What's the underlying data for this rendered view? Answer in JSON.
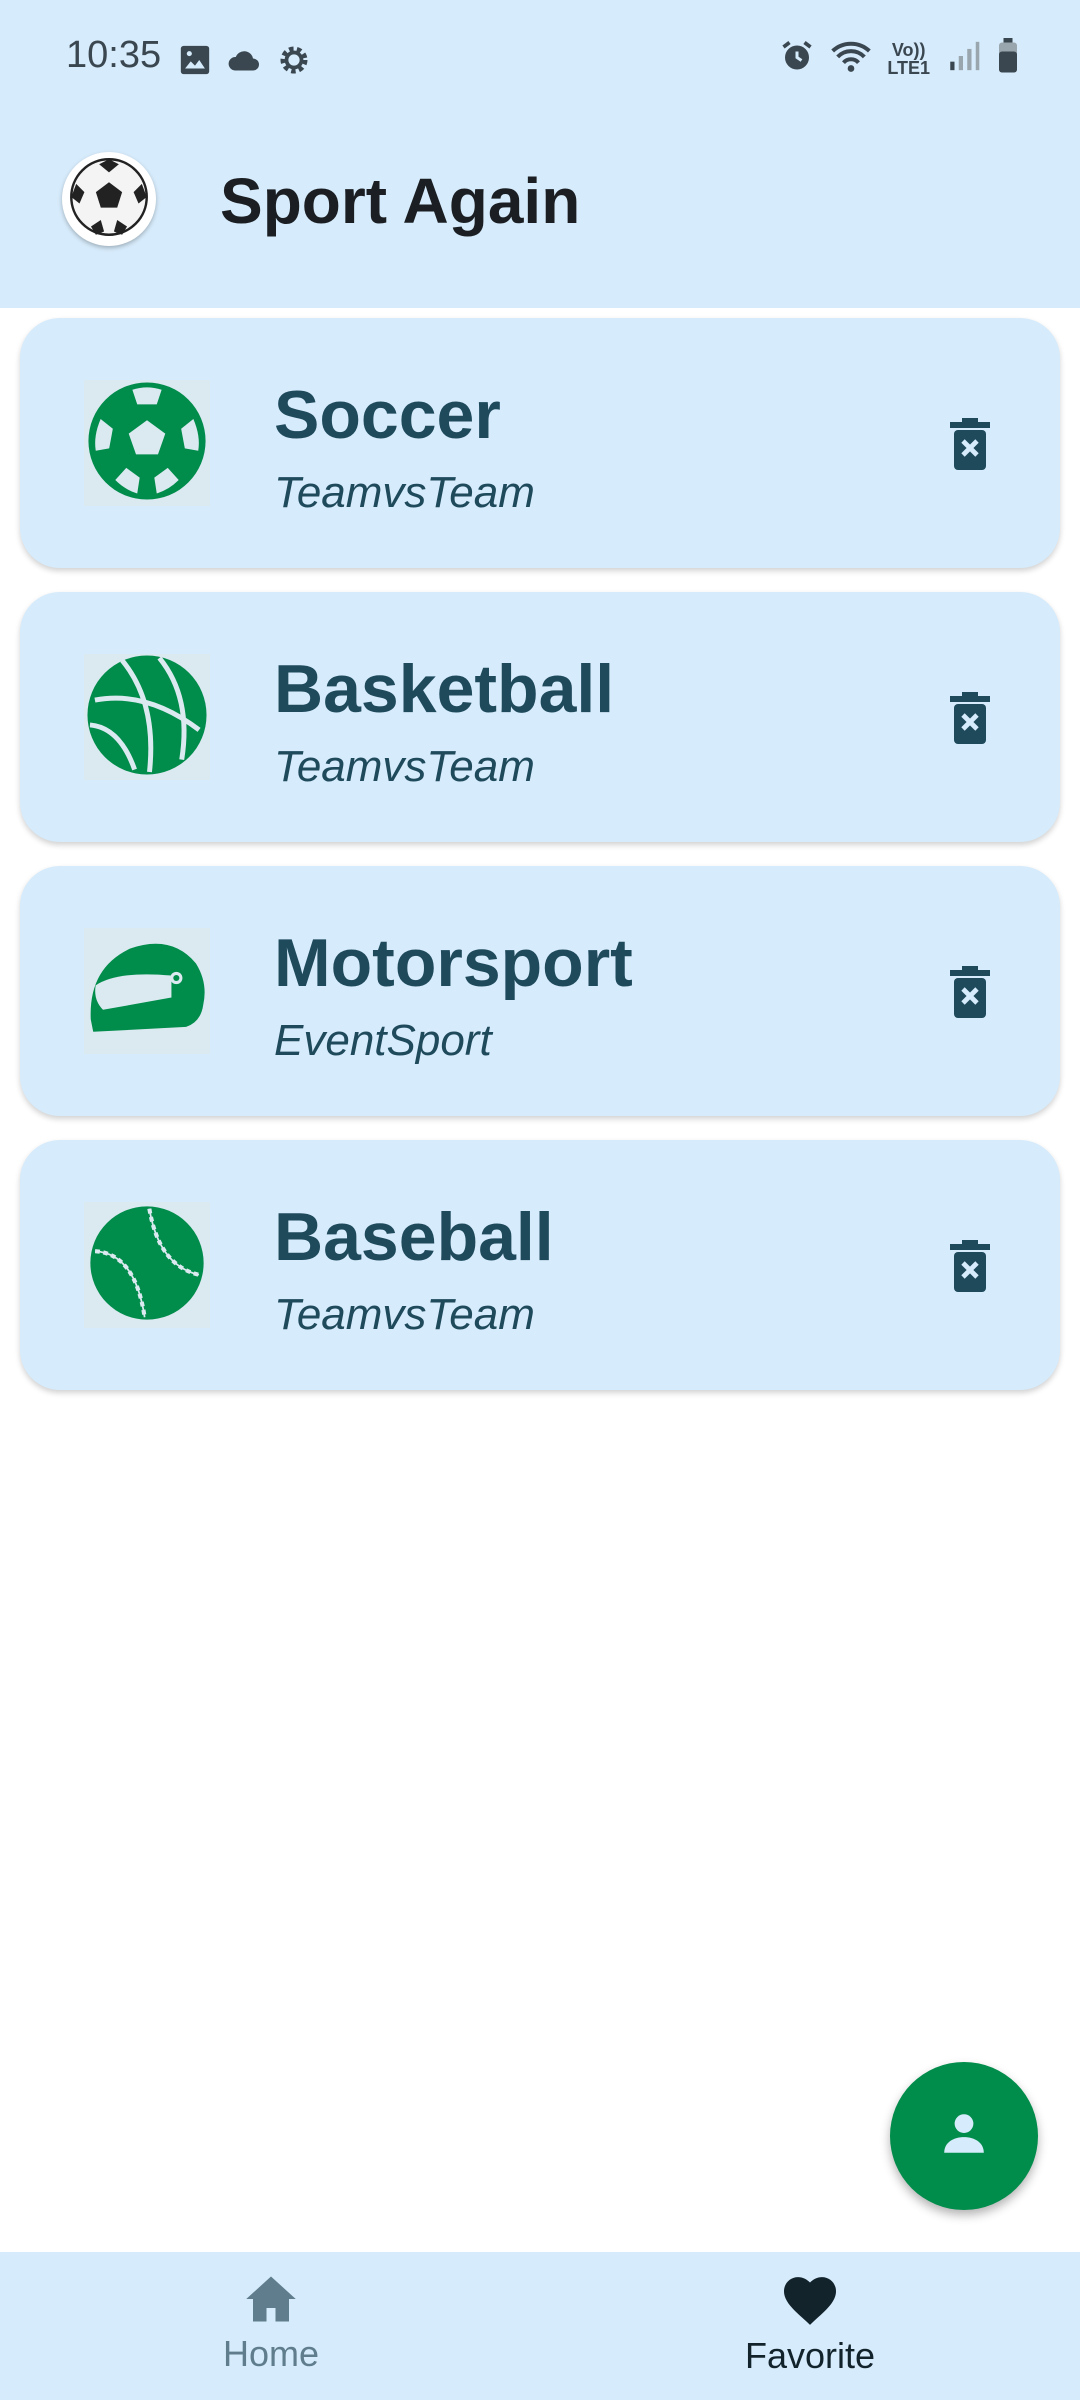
{
  "status_bar": {
    "time": "10:35",
    "left_icons": [
      "image-icon",
      "cloud-icon",
      "settings-gear-icon"
    ],
    "right_icons": [
      "alarm-icon",
      "wifi-icon",
      "volte-icon",
      "signal-icon",
      "battery-icon"
    ],
    "volte_line1": "Vo))",
    "volte_line2": "LTE1"
  },
  "app_bar": {
    "title": "Sport Again",
    "logo_icon": "soccer-ball-icon"
  },
  "sports": [
    {
      "name": "Soccer",
      "type": "TeamvsTeam",
      "icon": "soccer-ball-icon"
    },
    {
      "name": "Basketball",
      "type": "TeamvsTeam",
      "icon": "basketball-icon"
    },
    {
      "name": "Motorsport",
      "type": "EventSport",
      "icon": "racing-helmet-icon"
    },
    {
      "name": "Baseball",
      "type": "TeamvsTeam",
      "icon": "baseball-icon"
    }
  ],
  "fab": {
    "icon": "person-icon"
  },
  "bottom_nav": {
    "items": [
      {
        "label": "Home",
        "icon": "home-icon",
        "selected": false
      },
      {
        "label": "Favorite",
        "icon": "heart-icon",
        "selected": true
      }
    ]
  },
  "colors": {
    "surface": "#d6ebfb",
    "accent_green": "#008c4a",
    "text_dark_teal": "#1e4a5c",
    "nav_selected": "#12232c",
    "nav_unselected": "#5f7d8d"
  }
}
